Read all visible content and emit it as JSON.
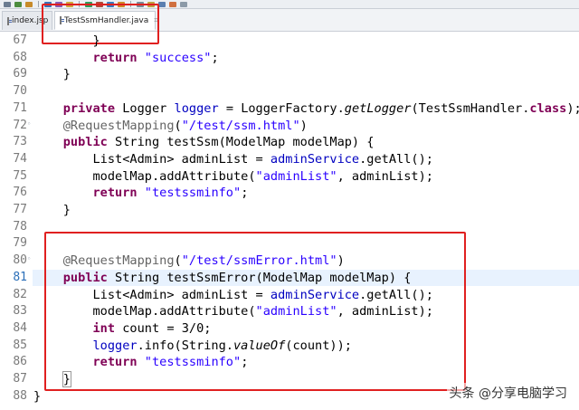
{
  "tabs": [
    {
      "label": "index.jsp",
      "active": false
    },
    {
      "label": "TestSsmHandler.java",
      "active": true
    }
  ],
  "close_glyph": "⌗",
  "lines": [
    {
      "num": "67",
      "tokens": [
        {
          "t": "        }",
          "c": "plain"
        }
      ]
    },
    {
      "num": "68",
      "tokens": [
        {
          "t": "        ",
          "c": "plain"
        },
        {
          "t": "return",
          "c": "kw"
        },
        {
          "t": " ",
          "c": "plain"
        },
        {
          "t": "\"success\"",
          "c": "str"
        },
        {
          "t": ";",
          "c": "plain"
        }
      ]
    },
    {
      "num": "69",
      "tokens": [
        {
          "t": "    }",
          "c": "plain"
        }
      ]
    },
    {
      "num": "70",
      "tokens": []
    },
    {
      "num": "71",
      "tokens": [
        {
          "t": "    ",
          "c": "plain"
        },
        {
          "t": "private",
          "c": "kw"
        },
        {
          "t": " Logger ",
          "c": "plain"
        },
        {
          "t": "logger",
          "c": "fld"
        },
        {
          "t": " = LoggerFactory.",
          "c": "plain"
        },
        {
          "t": "getLogger",
          "c": "ital"
        },
        {
          "t": "(TestSsmHandler.",
          "c": "plain"
        },
        {
          "t": "class",
          "c": "kw"
        },
        {
          "t": ");",
          "c": "plain"
        }
      ]
    },
    {
      "num": "72",
      "fold": true,
      "tokens": [
        {
          "t": "    ",
          "c": "plain"
        },
        {
          "t": "@RequestMapping",
          "c": "ann"
        },
        {
          "t": "(",
          "c": "plain"
        },
        {
          "t": "\"/test/ssm.html\"",
          "c": "str"
        },
        {
          "t": ")",
          "c": "plain"
        }
      ]
    },
    {
      "num": "73",
      "tokens": [
        {
          "t": "    ",
          "c": "plain"
        },
        {
          "t": "public",
          "c": "kw"
        },
        {
          "t": " String testSsm(ModelMap modelMap) {",
          "c": "plain"
        }
      ]
    },
    {
      "num": "74",
      "tokens": [
        {
          "t": "        List<Admin> adminList = ",
          "c": "plain"
        },
        {
          "t": "adminService",
          "c": "fld"
        },
        {
          "t": ".getAll();",
          "c": "plain"
        }
      ]
    },
    {
      "num": "75",
      "tokens": [
        {
          "t": "        modelMap.addAttribute(",
          "c": "plain"
        },
        {
          "t": "\"adminList\"",
          "c": "str"
        },
        {
          "t": ", adminList);",
          "c": "plain"
        }
      ]
    },
    {
      "num": "76",
      "tokens": [
        {
          "t": "        ",
          "c": "plain"
        },
        {
          "t": "return",
          "c": "kw"
        },
        {
          "t": " ",
          "c": "plain"
        },
        {
          "t": "\"testssminfo\"",
          "c": "str"
        },
        {
          "t": ";",
          "c": "plain"
        }
      ]
    },
    {
      "num": "77",
      "tokens": [
        {
          "t": "    }",
          "c": "plain"
        }
      ]
    },
    {
      "num": "78",
      "tokens": []
    },
    {
      "num": "79",
      "tokens": []
    },
    {
      "num": "80",
      "fold": true,
      "tokens": [
        {
          "t": "    ",
          "c": "plain"
        },
        {
          "t": "@RequestMapping",
          "c": "ann"
        },
        {
          "t": "(",
          "c": "plain"
        },
        {
          "t": "\"/test/ssmError.html\"",
          "c": "str"
        },
        {
          "t": ")",
          "c": "plain"
        }
      ]
    },
    {
      "num": "81",
      "current": true,
      "tokens": [
        {
          "t": "    ",
          "c": "plain"
        },
        {
          "t": "public",
          "c": "kw"
        },
        {
          "t": " String testSsmError(ModelMap modelMap) {",
          "c": "plain"
        }
      ]
    },
    {
      "num": "82",
      "tokens": [
        {
          "t": "        List<Admin> adminList = ",
          "c": "plain"
        },
        {
          "t": "adminService",
          "c": "fld"
        },
        {
          "t": ".getAll();",
          "c": "plain"
        }
      ]
    },
    {
      "num": "83",
      "tokens": [
        {
          "t": "        modelMap.addAttribute(",
          "c": "plain"
        },
        {
          "t": "\"adminList\"",
          "c": "str"
        },
        {
          "t": ", adminList);",
          "c": "plain"
        }
      ]
    },
    {
      "num": "84",
      "tokens": [
        {
          "t": "        ",
          "c": "plain"
        },
        {
          "t": "int",
          "c": "kw"
        },
        {
          "t": " count = 3/0;",
          "c": "plain"
        }
      ]
    },
    {
      "num": "85",
      "tokens": [
        {
          "t": "        ",
          "c": "plain"
        },
        {
          "t": "logger",
          "c": "fld"
        },
        {
          "t": ".info(String.",
          "c": "plain"
        },
        {
          "t": "valueOf",
          "c": "ital"
        },
        {
          "t": "(count));",
          "c": "plain"
        }
      ]
    },
    {
      "num": "86",
      "tokens": [
        {
          "t": "        ",
          "c": "plain"
        },
        {
          "t": "return",
          "c": "kw"
        },
        {
          "t": " ",
          "c": "plain"
        },
        {
          "t": "\"testssminfo\"",
          "c": "str"
        },
        {
          "t": ";",
          "c": "plain"
        }
      ]
    },
    {
      "num": "87",
      "tokens": [
        {
          "t": "    ",
          "c": "plain"
        },
        {
          "t": "}",
          "c": "bracket"
        }
      ]
    },
    {
      "num": "88",
      "tokens": [
        {
          "t": "}",
          "c": "plain"
        }
      ]
    }
  ],
  "watermark": "头条 @分享电脑学习",
  "colors": {
    "highlight": "#e02020",
    "keyword": "#7f0055",
    "string": "#2a00ff",
    "field": "#0000c0"
  }
}
